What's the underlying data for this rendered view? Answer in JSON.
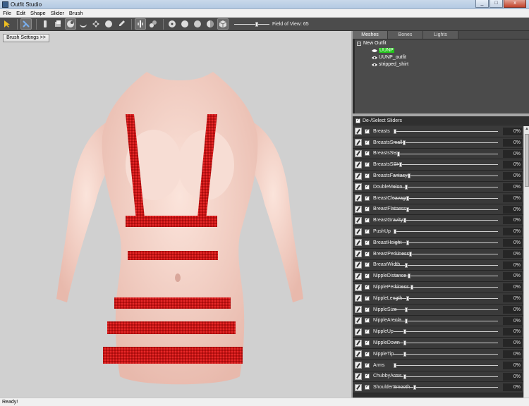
{
  "window": {
    "title": "Outfit Studio",
    "minimize": "_",
    "maximize": "□",
    "close": "x"
  },
  "menu": [
    "File",
    "Edit",
    "Shape",
    "Slider",
    "Brush"
  ],
  "toolbar": {
    "fov_label": "Field of View: 65",
    "fov_value": 65
  },
  "viewport": {
    "brush_settings_label": "Brush Settings >>"
  },
  "tabs": [
    "Meshes",
    "Bones",
    "Lights"
  ],
  "tree": {
    "expander": "−",
    "root": "New Outfit",
    "items": [
      "UUNP",
      "UUNP_outfit",
      "stripped_shirt"
    ],
    "selected": "UUNP"
  },
  "sliders_header": "De-/Select Sliders",
  "sliders": [
    {
      "name": "Breasts",
      "value": "0%"
    },
    {
      "name": "BreastsSmall",
      "value": "0%"
    },
    {
      "name": "BreastsSH",
      "value": "0%"
    },
    {
      "name": "BreastsSSH",
      "value": "0%"
    },
    {
      "name": "BreastsFantasy",
      "value": "0%"
    },
    {
      "name": "DoubleMelon",
      "value": "0%"
    },
    {
      "name": "BreastCleavage",
      "value": "0%"
    },
    {
      "name": "BreastFlatness",
      "value": "0%"
    },
    {
      "name": "BreastGravity",
      "value": "0%"
    },
    {
      "name": "PushUp",
      "value": "0%"
    },
    {
      "name": "BreastHeight",
      "value": "0%"
    },
    {
      "name": "BreastPerkiness",
      "value": "0%"
    },
    {
      "name": "BreastWidth",
      "value": "0%"
    },
    {
      "name": "NippleDistance",
      "value": "0%"
    },
    {
      "name": "NipplePerkiness",
      "value": "0%"
    },
    {
      "name": "NippleLength",
      "value": "0%"
    },
    {
      "name": "NippleSize",
      "value": "0%"
    },
    {
      "name": "NippleAreola",
      "value": "0%"
    },
    {
      "name": "NippleUp",
      "value": "0%"
    },
    {
      "name": "NippleDown",
      "value": "0%"
    },
    {
      "name": "NippleTip",
      "value": "0%"
    },
    {
      "name": "Arms",
      "value": "0%"
    },
    {
      "name": "ChubbyArms",
      "value": "0%"
    },
    {
      "name": "ShoulderSmooth",
      "value": "0%"
    }
  ],
  "status": "Ready!",
  "colors": {
    "accent_selected": "#22c41a",
    "outfit_red": "#c81414",
    "skin": "#f3d2c8"
  }
}
